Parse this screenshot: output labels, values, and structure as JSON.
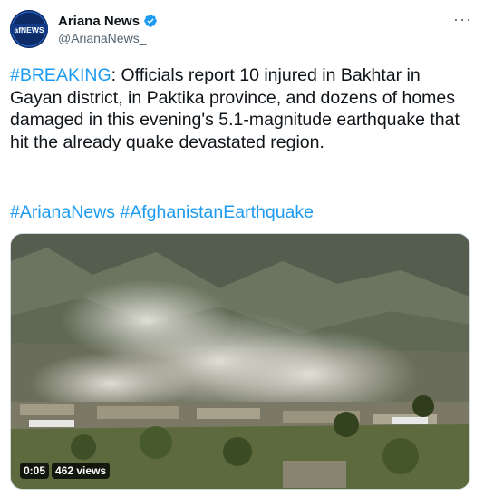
{
  "tweet": {
    "display_name": "Ariana News",
    "handle": "@ArianaNews_",
    "avatar_text": "afNEWS",
    "more_label": "···",
    "hashtag_breaking": "#BREAKING",
    "body_text": ": Officials report 10 injured in Bakhtar in Gayan district, in Paktika province, and dozens of homes damaged in this evening's 5.1-magnitude earthquake that hit the already quake devastated region.",
    "hashtags": [
      "#AfghanistanEarthquake",
      "#ArianaNews"
    ]
  },
  "video": {
    "duration": "0:05",
    "views": "462 views"
  },
  "colors": {
    "link": "#1d9bf0",
    "text": "#0f1419",
    "secondary": "#536471",
    "verified": "#1d9bf0"
  }
}
